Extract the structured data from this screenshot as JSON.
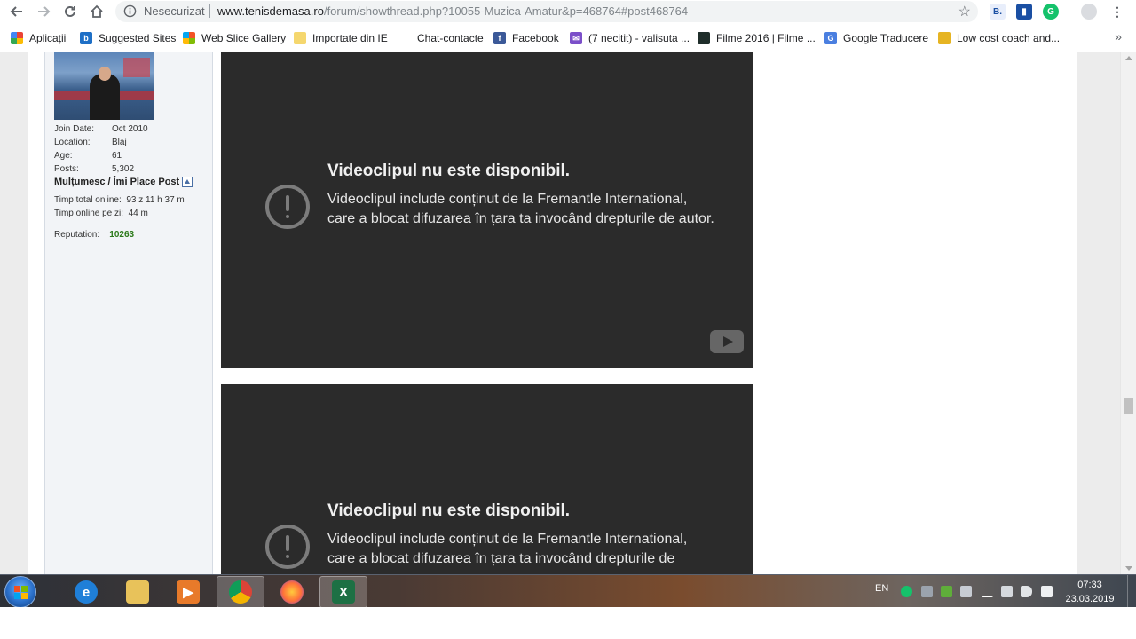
{
  "browser": {
    "security_label": "Nesecurizat",
    "url_host": "www.tenisdemasa.ro",
    "url_path": "/forum/showthread.php?10055-Muzica-Amatur&p=468764#post468764"
  },
  "bookmarks": {
    "items": [
      {
        "label": "Aplicații",
        "icon": "apps-icon"
      },
      {
        "label": "Suggested Sites",
        "icon": "bing-icon"
      },
      {
        "label": "Web Slice Gallery",
        "icon": "windows-icon"
      },
      {
        "label": "Importate din IE",
        "icon": "folder-icon"
      },
      {
        "label": "Chat-contacte",
        "icon": "blank-icon"
      },
      {
        "label": "Facebook",
        "icon": "facebook-icon"
      },
      {
        "label": "(7 necitit) - valisuta ...",
        "icon": "mail-icon"
      },
      {
        "label": "Filme 2016 | Filme ...",
        "icon": "film-icon"
      },
      {
        "label": "Google Traducere",
        "icon": "translate-icon"
      },
      {
        "label": "Low cost coach and...",
        "icon": "bus-icon"
      }
    ],
    "more_label": "»"
  },
  "user": {
    "join_label": "Join Date:",
    "join_value": "Oct 2010",
    "location_label": "Location:",
    "location_value": "Blaj",
    "age_label": "Age:",
    "age_value": "61",
    "posts_label": "Posts:",
    "posts_value": "5,302",
    "thanks_label": "Mulțumesc / Îmi Place Post",
    "online_total_label": "Timp total online:",
    "online_total_value": "93 z 11 h 37 m",
    "online_day_label": "Timp online pe zi:",
    "online_day_value": "44 m",
    "reputation_label": "Reputation:",
    "reputation_value": "10263"
  },
  "videos": [
    {
      "title": "Videoclipul nu este disponibil.",
      "message": "Videoclipul include conținut de la Fremantle International, care a blocat difuzarea în țara ta invocând drepturile de autor."
    },
    {
      "title": "Videoclipul nu este disponibil.",
      "message": "Videoclipul include conținut de la Fremantle International, care a blocat difuzarea în țara ta invocând drepturile de"
    }
  ],
  "taskbar": {
    "apps": [
      "internet-explorer-icon",
      "file-explorer-icon",
      "media-player-icon",
      "chrome-icon",
      "firefox-icon",
      "excel-icon"
    ],
    "language": "EN",
    "time": "07:33",
    "date": "23.03.2019"
  },
  "colors": {
    "video_bg": "#2b2b2b",
    "reputation": "#2c7a1a",
    "user_panel_bg": "#f2f4f7"
  }
}
